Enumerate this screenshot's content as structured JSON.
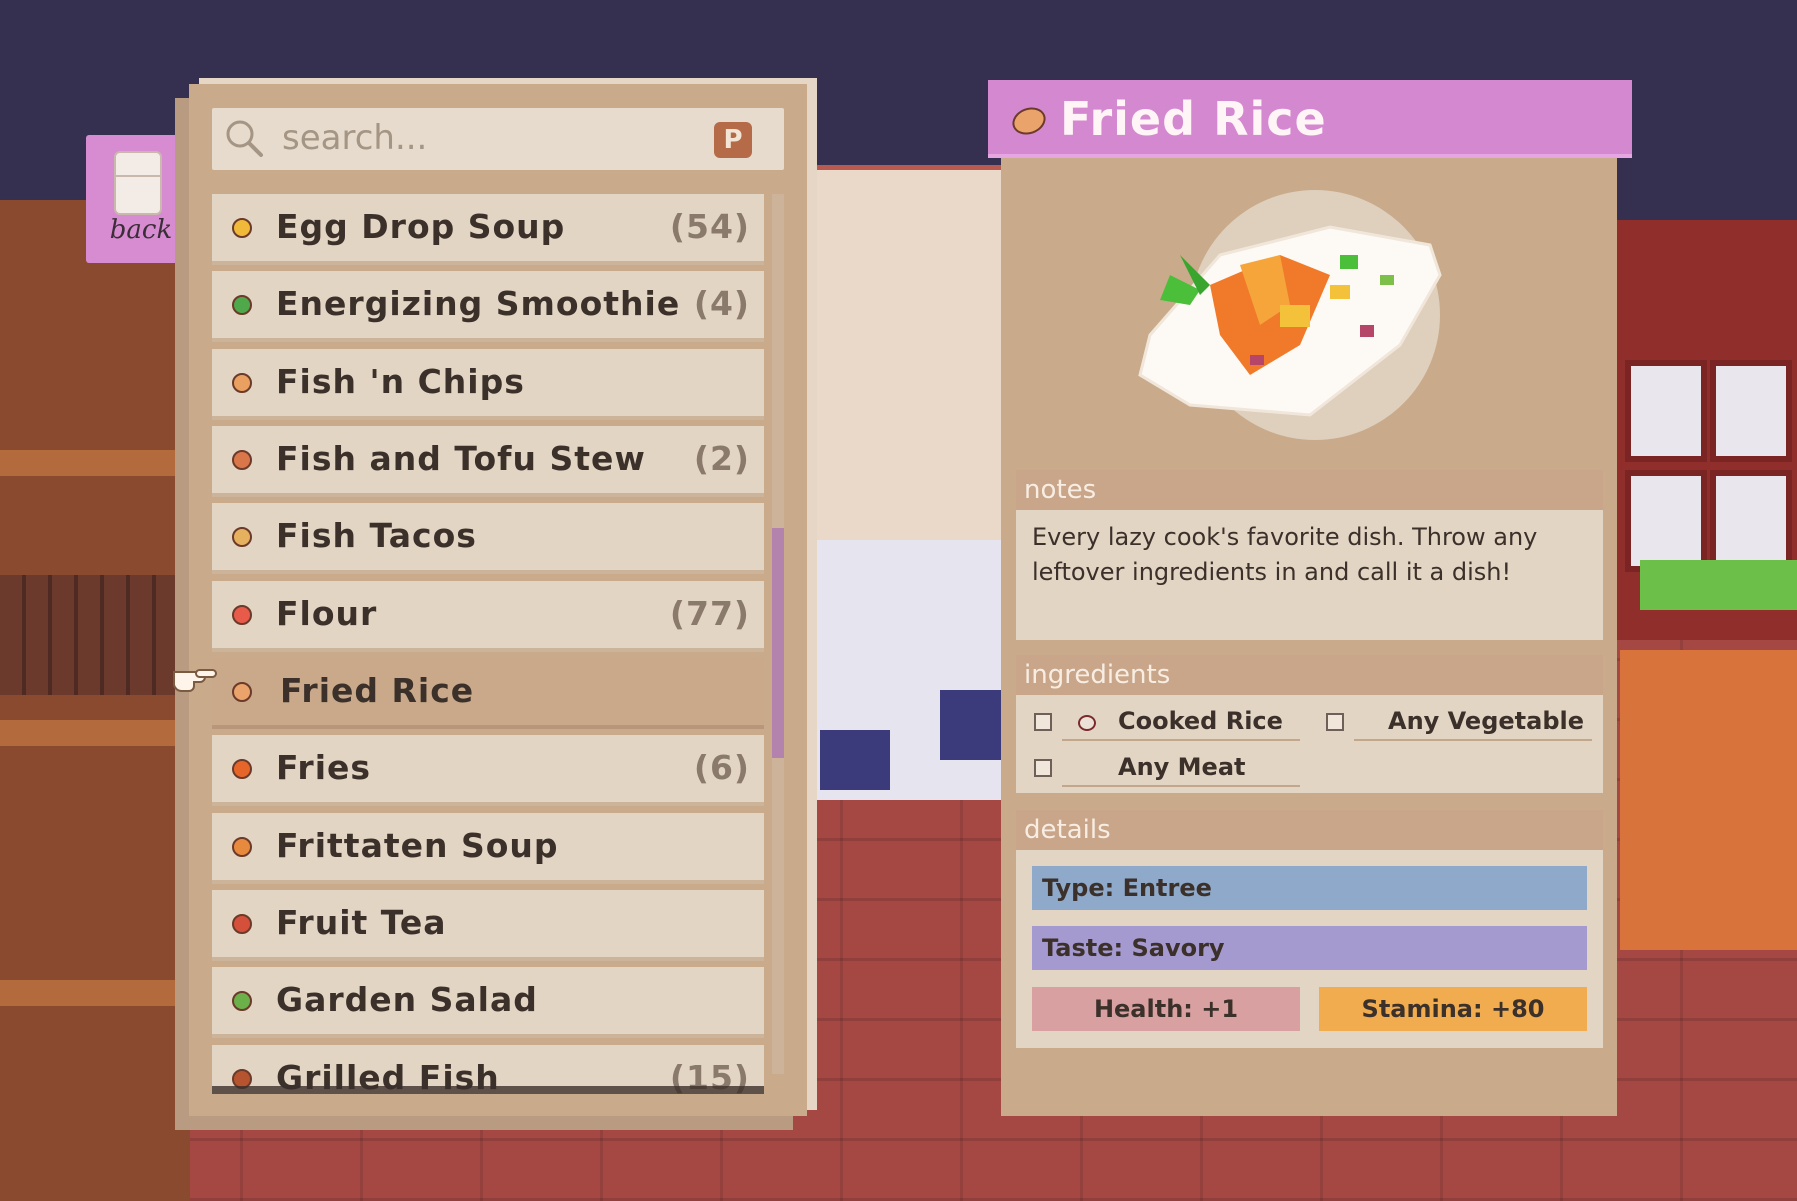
{
  "back": {
    "label": "back"
  },
  "search": {
    "placeholder": "search...",
    "hotkey": "P"
  },
  "recipes": [
    {
      "name": "Egg Drop Soup",
      "count": "(54)",
      "icon_color": "#f0b93a"
    },
    {
      "name": "Energizing Smoothie",
      "count": "(4)",
      "icon_color": "#4fa84a"
    },
    {
      "name": "Fish 'n Chips",
      "count": "",
      "icon_color": "#e9a060"
    },
    {
      "name": "Fish and Tofu Stew",
      "count": "(2)",
      "icon_color": "#d9774a"
    },
    {
      "name": "Fish Tacos",
      "count": "",
      "icon_color": "#e6b15e"
    },
    {
      "name": "Flour",
      "count": "(77)",
      "icon_color": "#e85b4a"
    },
    {
      "name": "Fried Rice",
      "count": "",
      "icon_color": "#e9a36b",
      "selected": true
    },
    {
      "name": "Fries",
      "count": "(6)",
      "icon_color": "#e6662a"
    },
    {
      "name": "Frittaten Soup",
      "count": "",
      "icon_color": "#e88a3e"
    },
    {
      "name": "Fruit Tea",
      "count": "",
      "icon_color": "#d4503a"
    },
    {
      "name": "Garden Salad",
      "count": "",
      "icon_color": "#6cb04a"
    },
    {
      "name": "Grilled Fish",
      "count": "(15)",
      "icon_color": "#b5542e"
    }
  ],
  "detail": {
    "title": "Fried Rice",
    "notes_header": "notes",
    "notes": "Every lazy cook's favorite dish. Throw any leftover ingredients in and call it a dish!",
    "ingredients_header": "ingredients",
    "ingredients": [
      {
        "name": "Cooked Rice"
      },
      {
        "name": "Any Vegetable"
      },
      {
        "name": "Any Meat"
      }
    ],
    "details_header": "details",
    "type": "Type: Entree",
    "taste": "Taste: Savory",
    "health": "Health: +1",
    "stamina": "Stamina: +80"
  }
}
